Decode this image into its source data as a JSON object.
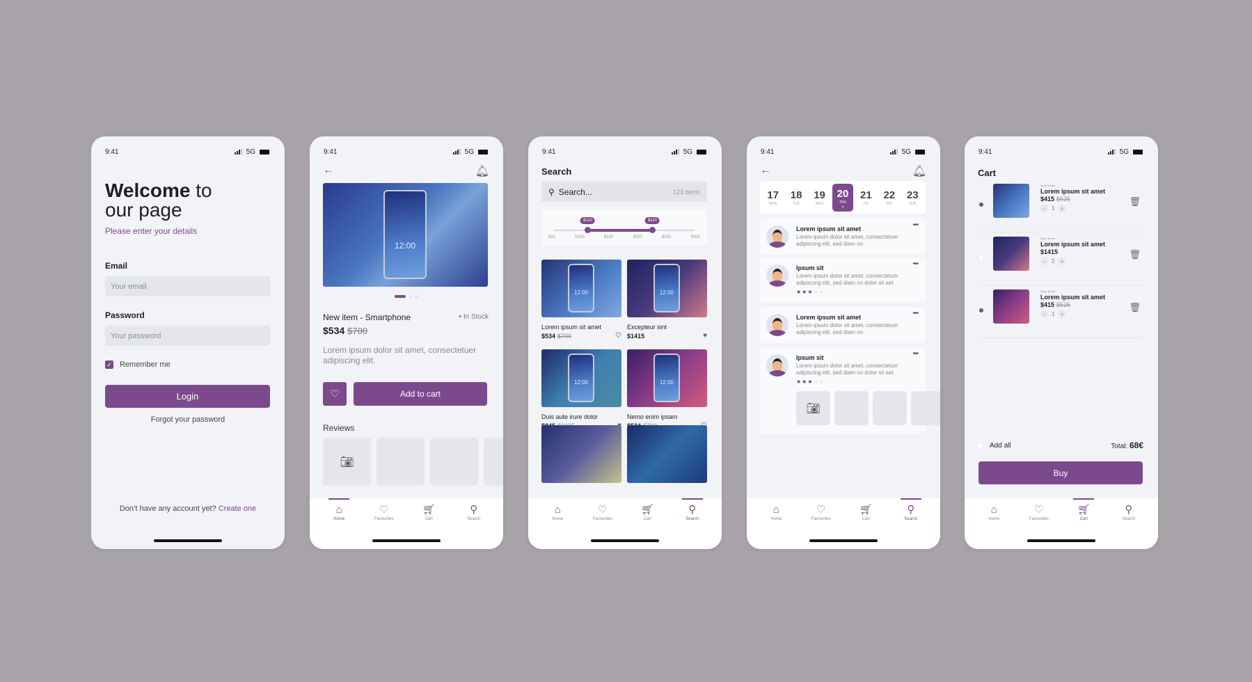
{
  "status": {
    "time": "9:41",
    "network": "5G"
  },
  "tabbar": [
    {
      "label": "Home",
      "icon": "home-icon"
    },
    {
      "label": "Favourites",
      "icon": "heart-icon"
    },
    {
      "label": "Cart",
      "icon": "cart-icon"
    },
    {
      "label": "Search",
      "icon": "search-icon"
    }
  ],
  "login": {
    "title_bold": "Welcome",
    "title_rest": " to",
    "title_line2": "our page",
    "subtitle": "Please enter your details",
    "email_label": "Email",
    "email_placeholder": "Your email",
    "password_label": "Password",
    "password_placeholder": "Your password",
    "remember": "Remember me",
    "remember_checked": true,
    "login_button": "Login",
    "forgot": "Forgot your password",
    "no_account": "Don’t have any account yet?",
    "create": "Create one"
  },
  "product": {
    "hero_time": "12:00",
    "carousel": {
      "count": 3,
      "active": 1
    },
    "title": "New item - Smartphone",
    "stock": "In Stock",
    "price": "$534",
    "old_price": "$700",
    "description": "Lorem ipsum dolor sit amet, consectetuer adipiscing elit.",
    "add_to_cart": "Add to cart",
    "reviews_label": "Reviews",
    "active_tab": "Home"
  },
  "search": {
    "title": "Search",
    "placeholder": "Search...",
    "count": "123 items",
    "range": {
      "min_label": "$110",
      "max_label": "$110",
      "min": 110,
      "max": 225,
      "lo": 50,
      "hi": 300,
      "ticks": [
        "$50",
        "$100",
        "$150",
        "$200",
        "$250",
        "$300"
      ]
    },
    "items": [
      {
        "name": "Lorem ipsum sit amet",
        "price": "$534",
        "old": "$700",
        "fav": false,
        "style": "g1"
      },
      {
        "name": "Excepteur sint",
        "price": "$1415",
        "old": "",
        "fav": true,
        "style": "g2"
      },
      {
        "name": "Duis aute irure dolor",
        "price": "$845",
        "old": "$1025",
        "fav": true,
        "style": "g3"
      },
      {
        "name": "Nemo enim ipsam",
        "price": "$534",
        "old": "$700",
        "fav": false,
        "style": "g4"
      }
    ],
    "active_tab": "Search"
  },
  "reviews": {
    "days": [
      {
        "n": "17",
        "w": "MON"
      },
      {
        "n": "18",
        "w": "TUE"
      },
      {
        "n": "19",
        "w": "WED"
      },
      {
        "n": "20",
        "w": "THU",
        "active": true
      },
      {
        "n": "21",
        "w": "FRI"
      },
      {
        "n": "22",
        "w": "SAT"
      },
      {
        "n": "23",
        "w": "SUN"
      }
    ],
    "list": [
      {
        "title": "Lorem ipsum sit amet",
        "body": "Lorem ipsum dolor sit amet, consectetuer adipiscing elit, sed diam no"
      },
      {
        "title": "Ipsum sit",
        "body": "Lorem ipsum dolor sit amet, consectetuer adipiscing elit, sed diam no dolor sit aet.",
        "stars": 3
      },
      {
        "title": "Lorem ipsum sit amet",
        "body": "Lorem ipsum dolor sit amet, consectetuer adipiscing elit, sed diam no"
      },
      {
        "title": "Ipsum sit",
        "body": "Lorem ipsum dolor sit amet, consectetuer adipiscing elit, sed diam no dolor sit aet.",
        "stars": 3
      }
    ],
    "active_tab": "Search"
  },
  "cart": {
    "title": "Cart",
    "items": [
      {
        "small": "Dolor sit am",
        "name": "Lorem ipsum sit amet",
        "price": "$415",
        "old": "$525",
        "qty": "1",
        "selected": true,
        "style": "g1"
      },
      {
        "small": "Dolor sit am",
        "name": "Lorem ipsum sit amet",
        "price": "$1415",
        "old": "",
        "qty": "2",
        "selected": false,
        "style": "g2"
      },
      {
        "small": "Dolor sit am",
        "name": "Lorem ipsum sit amet",
        "price": "$415",
        "old": "$525",
        "qty": "1",
        "selected": true,
        "style": "g4"
      }
    ],
    "add_all": "Add all",
    "total_label": "Total:",
    "total_value": "68€",
    "buy": "Buy",
    "active_tab": "Cart"
  }
}
